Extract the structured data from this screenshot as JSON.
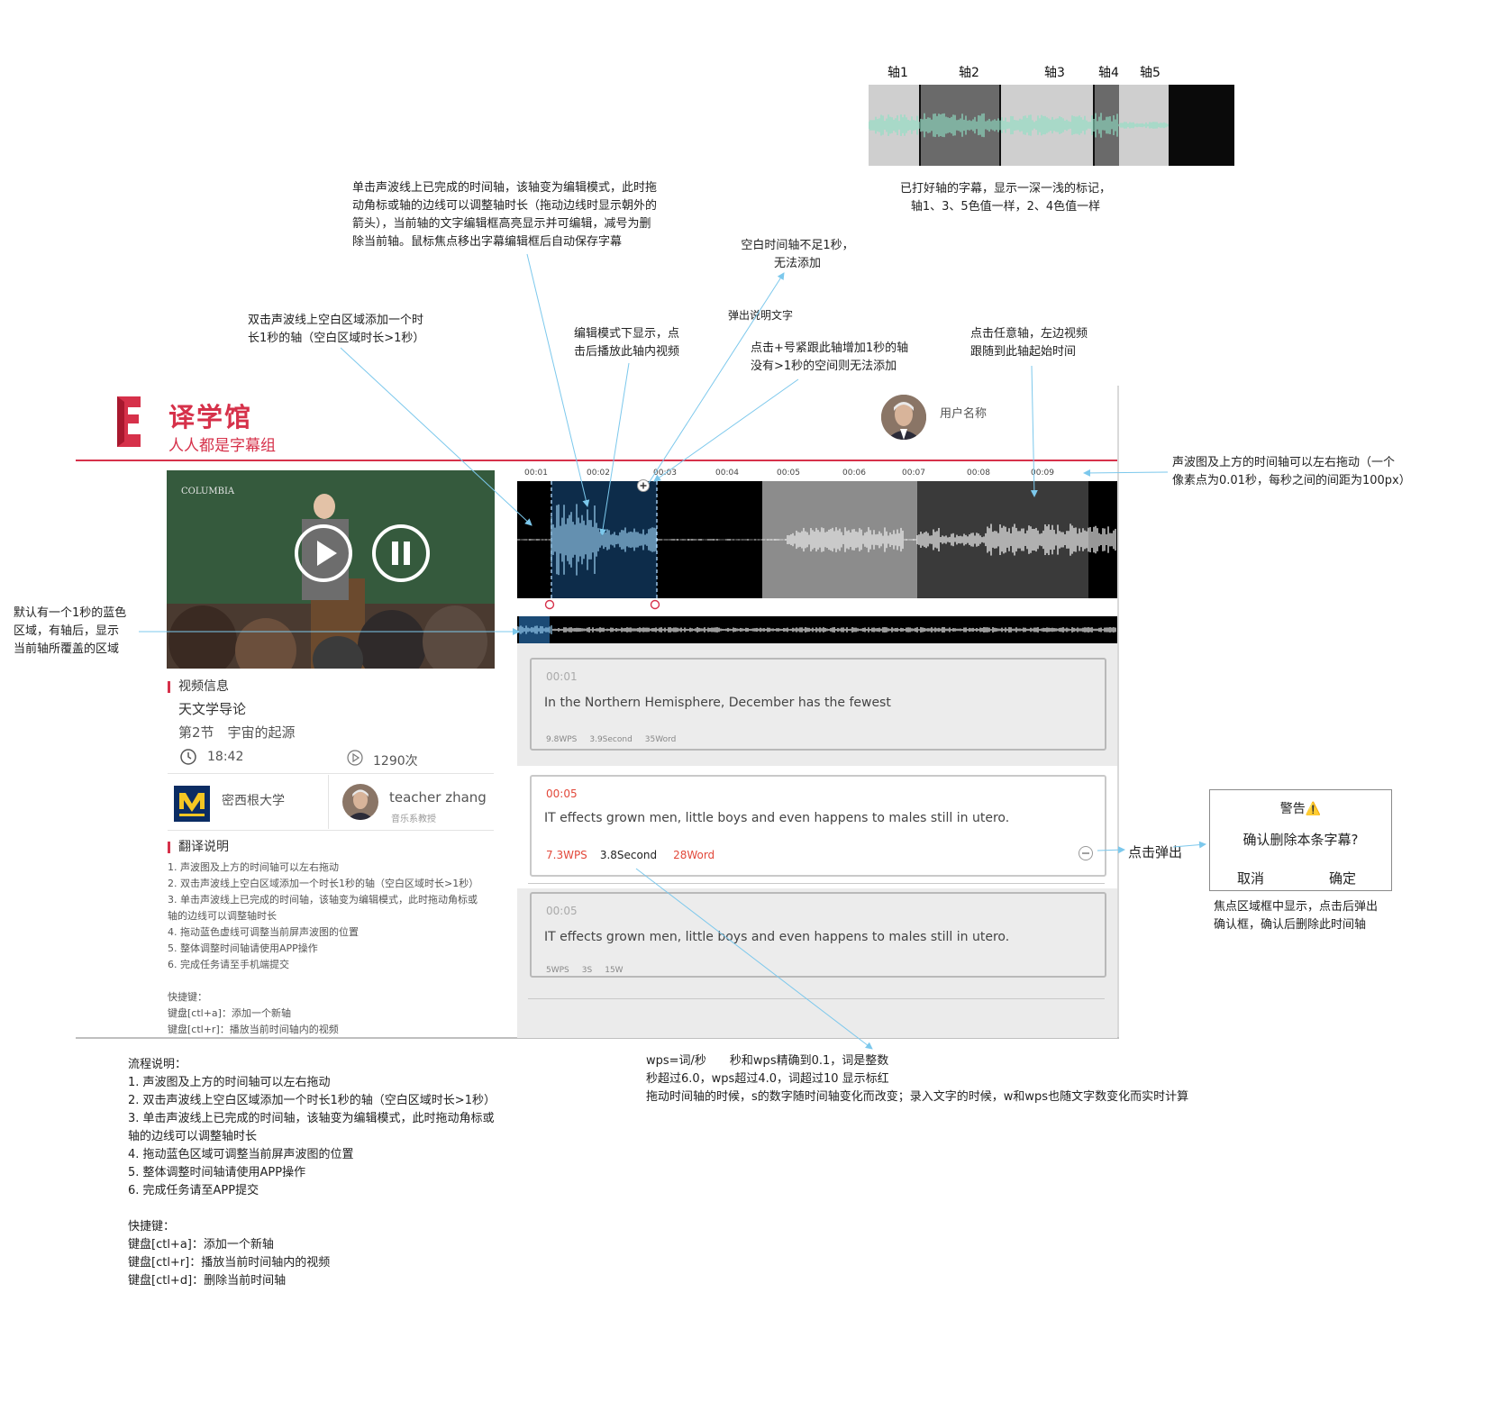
{
  "legend": {
    "axes": [
      "轴1",
      "轴2",
      "轴3",
      "轴4",
      "轴5"
    ],
    "caption_line1": "已打好轴的字幕，显示一深一浅的标记，",
    "caption_line2": "轴1、3、5色值一样，2、4色值一样"
  },
  "annotations": {
    "click_axis": [
      "单击声波线上已完成的时间轴，该轴变为编辑模式，此时拖",
      "动角标或轴的边线可以调整轴时长（拖动边线时显示朝外的",
      "箭头），当前轴的文字编辑框高亮显示并可编辑，减号为删",
      "除当前轴。鼠标焦点移出字幕编辑框后自动保存字幕"
    ],
    "blank_too_short": [
      "空白时间轴不足1秒，",
      "无法添加"
    ],
    "popup_tip": "弹出说明文字",
    "double_click": [
      "双击声波线上空白区域添加一个时",
      "长1秒的轴（空白区域时长>1秒）"
    ],
    "edit_mode_play": [
      "编辑模式下显示，点",
      "击后播放此轴内视频"
    ],
    "plus_follow": [
      "点击+号紧跟此轴增加1秒的轴",
      "没有>1秒的空间则无法添加"
    ],
    "click_any_axis": [
      "点击任意轴，左边视频",
      "跟随到此轴起始时间"
    ],
    "drag_timeline": [
      "声波图及上方的时间轴可以左右拖动（一个",
      "像素点为0.01秒，每秒之间的间距为100px）"
    ],
    "default_blue": [
      "默认有一个1秒的蓝色",
      "区域，有轴后，显示",
      "当前轴所覆盖的区域"
    ],
    "click_popup": "点击弹出",
    "focus_delete": [
      "焦点区域框中显示，点击后弹出",
      "确认框，确认后删除此时间轴"
    ],
    "wps_rules": [
      "wps=词/秒　　秒和wps精确到0.1，词是整数",
      "秒超过6.0，wps超过4.0，词超过10 显示标红",
      "拖动时间轴的时候，s的数字随时间轴变化而改变；录入文字的时候，w和wps也随文字数变化而实时计算"
    ],
    "flow": [
      "流程说明：",
      "1. 声波图及上方的时间轴可以左右拖动",
      "2. 双击声波线上空白区域添加一个时长1秒的轴（空白区域时长>1秒）",
      "3. 单击声波线上已完成的时间轴，该轴变为编辑模式，此时拖动角标或",
      "轴的边线可以调整轴时长",
      "4. 拖动蓝色区域可调整当前屏声波图的位置",
      "5. 整体调整时间轴请使用APP操作",
      "6. 完成任务请至APP提交",
      "",
      "快捷键：",
      "键盘[ctl+a]：添加一个新轴",
      "键盘[ctl+r]：播放当前时间轴内的视频",
      "键盘[ctl+d]：删除当前时间轴"
    ]
  },
  "app": {
    "logo_title": "译学馆",
    "logo_subtitle": "人人都是字幕组",
    "user_name": "用户名称",
    "video_watermark": "COLUMBIA",
    "video_info": {
      "section_title": "视频信息",
      "course": "天文学导论",
      "chapter": "第2节　宇宙的起源",
      "duration": "18:42",
      "plays": "1290次",
      "university": "密西根大学",
      "teacher": "teacher zhang",
      "teacher_title": "音乐系教授"
    },
    "guide": {
      "section_title": "翻译说明",
      "lines": [
        "1. 声波图及上方的时间轴可以左右拖动",
        "2. 双击声波线上空白区域添加一个时长1秒的轴（空白区域时长>1秒）",
        "3. 单击声波线上已完成的时间轴，该轴变为编辑模式，此时拖动角标或",
        "轴的边线可以调整轴时长",
        "4. 拖动蓝色虚线可调整当前屏声波图的位置",
        "5. 整体调整时间轴请使用APP操作",
        "6. 完成任务请至手机端提交",
        "",
        "快捷键：",
        "键盘[ctl+a]：添加一个新轴",
        "键盘[ctl+r]：播放当前时间轴内的视频"
      ]
    },
    "ruler": [
      "00:01",
      "00:02",
      "00:03",
      "00:04",
      "00:05",
      "00:06",
      "00:07",
      "00:08",
      "00:09"
    ],
    "subtitles": [
      {
        "time": "00:01",
        "text": "In the Northern Hemisphere, December has the fewest",
        "wps": "9.8WPS",
        "sec": "3.9Second",
        "words": "35Word"
      },
      {
        "time": "00:05",
        "text": "IT effects grown men, little boys and even happens to males still in utero.",
        "wps": "7.3WPS",
        "sec": "3.8Second",
        "words": "28Word"
      },
      {
        "time": "00:05",
        "text": "IT effects grown men, little boys and even happens to males still in utero.",
        "wps": "5WPS",
        "sec": "3S",
        "words": "15W"
      }
    ]
  },
  "dialog": {
    "title": "警告⚠️",
    "message": "确认删除本条字幕?",
    "cancel": "取消",
    "confirm": "确定"
  },
  "colors": {
    "brand": "#d6314a",
    "highlight": "#0d2c4a",
    "arrow": "#7cc8ec",
    "red_stat": "#e2483a"
  }
}
